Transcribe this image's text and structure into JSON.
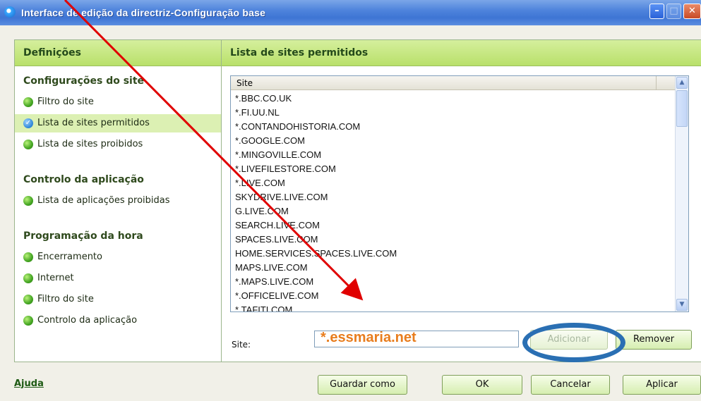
{
  "window": {
    "title": "Interface de edição da directriz-Configuração base",
    "min_icon": "minimize-icon",
    "max_icon": "maximize-icon",
    "close_icon": "close-icon"
  },
  "left_panel": {
    "header": "Definições",
    "sections": [
      {
        "title": "Configurações do site",
        "items": [
          "Filtro do site",
          "Lista de sites permitidos",
          "Lista de sites proibidos"
        ]
      },
      {
        "title": "Controlo da aplicação",
        "items": [
          "Lista de aplicações proibidas"
        ]
      },
      {
        "title": "Programação da hora",
        "items": [
          "Encerramento",
          "Internet",
          "Filtro do site",
          "Controlo da aplicação"
        ]
      }
    ],
    "selected_item": "Lista de sites permitidos"
  },
  "right_panel": {
    "header": "Lista de sites permitidos",
    "column_header": "Site",
    "sites": [
      "*.BBC.CO.UK",
      "*.FI.UU.NL",
      "*.CONTANDOHISTORIA.COM",
      "*.GOOGLE.COM",
      "*.MINGOVILLE.COM",
      "*.LIVEFILESTORE.COM",
      "*.LIVE.COM",
      "SKYDRIVE.LIVE.COM",
      "G.LIVE.COM",
      "SEARCH.LIVE.COM",
      "SPACES.LIVE.COM",
      "HOME.SERVICES.SPACES.LIVE.COM",
      "MAPS.LIVE.COM",
      "*.MAPS.LIVE.COM",
      "*.OFFICELIVE.COM",
      "*.TAFITI.COM"
    ],
    "site_label": "Site:",
    "site_input_value": "*.essmaria.net",
    "add_button": "Adicionar",
    "remove_button": "Remover"
  },
  "footer": {
    "help": "Ajuda",
    "save_as": "Guardar como",
    "ok": "OK",
    "cancel": "Cancelar",
    "apply": "Aplicar"
  },
  "colors": {
    "accent_green": "#b9e06a",
    "annotation_red": "#e00000",
    "annotation_blue": "#2a6fb3",
    "input_text_orange": "#e87d1e"
  }
}
